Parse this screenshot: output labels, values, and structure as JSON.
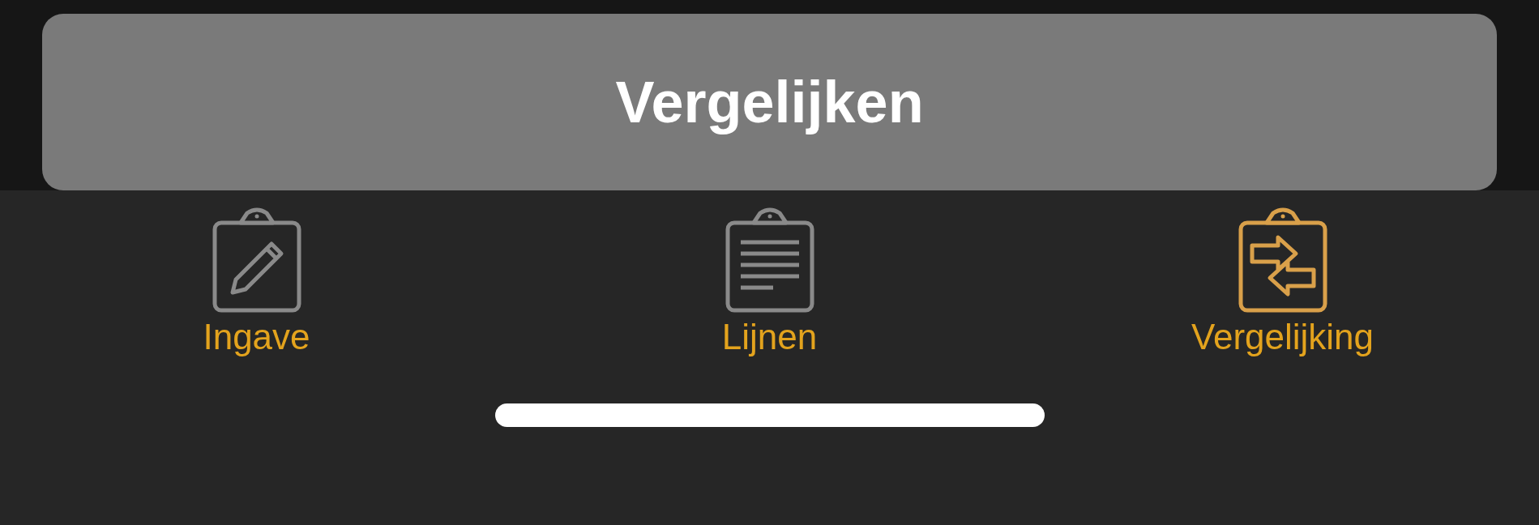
{
  "action_button": {
    "label": "Vergelijken"
  },
  "tabs": [
    {
      "label": "Ingave",
      "kind": "edit",
      "selected": false
    },
    {
      "label": "Lijnen",
      "kind": "list",
      "selected": false
    },
    {
      "label": "Vergelijking",
      "kind": "compare",
      "selected": true
    }
  ]
}
